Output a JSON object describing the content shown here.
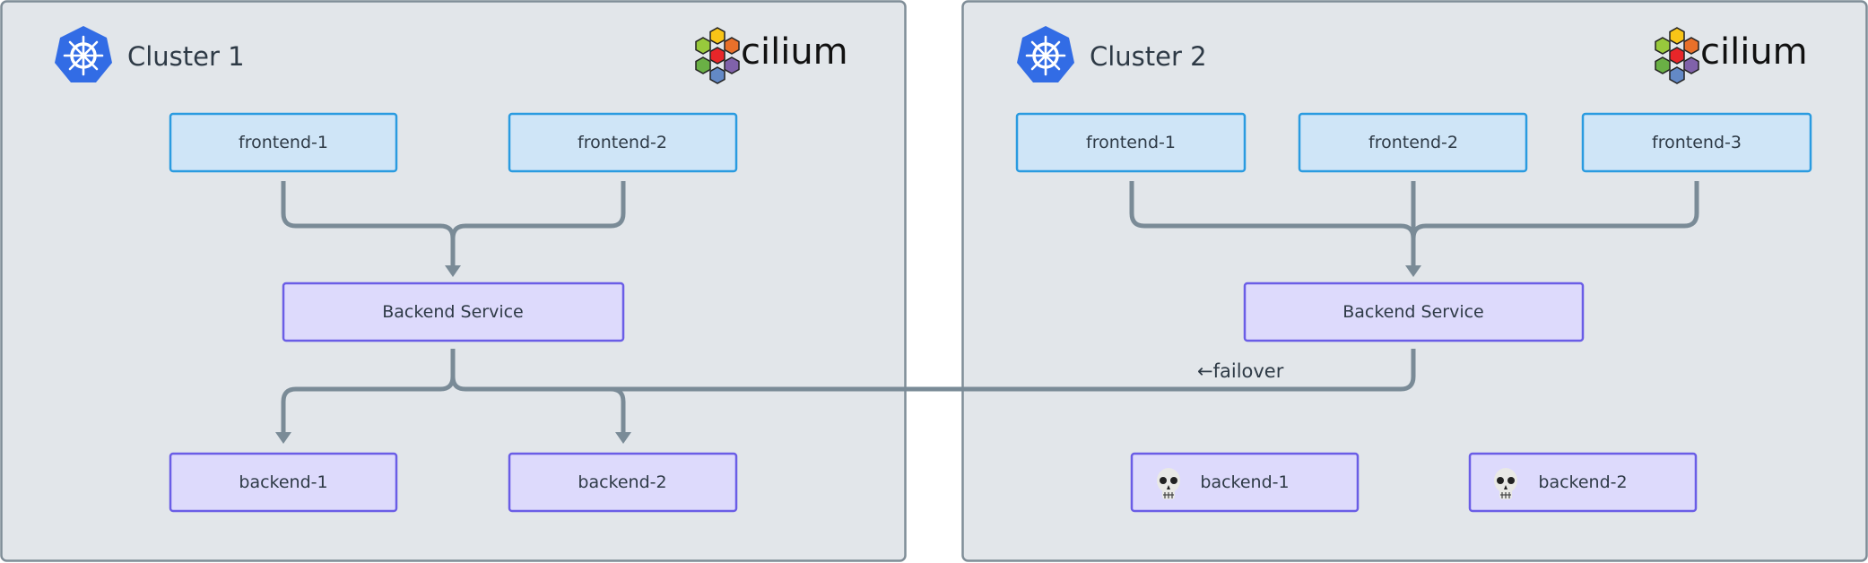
{
  "clusters": [
    {
      "title": "Cluster 1",
      "logo": "cilium",
      "frontends": [
        "frontend-1",
        "frontend-2"
      ],
      "service": "Backend Service",
      "backends": [
        {
          "label": "backend-1",
          "status": "healthy"
        },
        {
          "label": "backend-2",
          "status": "healthy"
        }
      ]
    },
    {
      "title": "Cluster 2",
      "logo": "cilium",
      "frontends": [
        "frontend-1",
        "frontend-2",
        "frontend-3"
      ],
      "service": "Backend Service",
      "backends": [
        {
          "label": "backend-1",
          "status": "dead",
          "icon": "skull-icon"
        },
        {
          "label": "backend-2",
          "status": "dead",
          "icon": "skull-icon"
        }
      ]
    }
  ],
  "failover_label": "←failover",
  "icons": {
    "cluster": "kubernetes-icon",
    "logo": "cilium-logo-icon",
    "dead": "skull-icon"
  },
  "colors": {
    "cluster_bg": "#e2e6ea",
    "frontend_fill": "#cfe5f7",
    "frontend_border": "#2a9be0",
    "backend_fill": "#dddafc",
    "backend_border": "#6a5de6",
    "connector": "#7a8b97",
    "kubernetes_blue": "#326ce5"
  }
}
